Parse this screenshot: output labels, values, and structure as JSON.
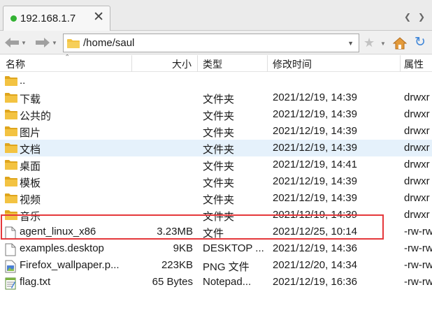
{
  "tab": {
    "title": "192.168.1.7",
    "close": "✕"
  },
  "navbar": {
    "path": "/home/saul"
  },
  "columns": {
    "name": "名称",
    "size": "大小",
    "type": "类型",
    "modified": "修改时间",
    "attr": "属性"
  },
  "colors": {
    "folder": "#f3c342",
    "folder_dark": "#dfa51d",
    "selected_row": "#e5f1fb",
    "highlight_box": "#e5383b",
    "reload": "#3f86d8",
    "online_dot": "#33b233"
  },
  "rows": [
    {
      "icon": "folder-icon",
      "name": "..",
      "size": "",
      "type": "",
      "modified": "",
      "attr": ""
    },
    {
      "icon": "folder-icon",
      "name": "下载",
      "size": "",
      "type": "文件夹",
      "modified": "2021/12/19, 14:39",
      "attr": "drwxr"
    },
    {
      "icon": "folder-icon",
      "name": "公共的",
      "size": "",
      "type": "文件夹",
      "modified": "2021/12/19, 14:39",
      "attr": "drwxr"
    },
    {
      "icon": "folder-icon",
      "name": "图片",
      "size": "",
      "type": "文件夹",
      "modified": "2021/12/19, 14:39",
      "attr": "drwxr"
    },
    {
      "icon": "folder-icon",
      "name": "文档",
      "size": "",
      "type": "文件夹",
      "modified": "2021/12/19, 14:39",
      "attr": "drwxr",
      "selected": true
    },
    {
      "icon": "folder-icon",
      "name": "桌面",
      "size": "",
      "type": "文件夹",
      "modified": "2021/12/19, 14:41",
      "attr": "drwxr"
    },
    {
      "icon": "folder-icon",
      "name": "模板",
      "size": "",
      "type": "文件夹",
      "modified": "2021/12/19, 14:39",
      "attr": "drwxr"
    },
    {
      "icon": "folder-icon",
      "name": "视频",
      "size": "",
      "type": "文件夹",
      "modified": "2021/12/19, 14:39",
      "attr": "drwxr"
    },
    {
      "icon": "folder-icon",
      "name": "音乐",
      "size": "",
      "type": "文件夹",
      "modified": "2021/12/19, 14:39",
      "attr": "drwxr"
    },
    {
      "icon": "file-icon",
      "name": "agent_linux_x86",
      "size": "3.23MB",
      "type": "文件",
      "modified": "2021/12/25, 10:14",
      "attr": "-rw-rw"
    },
    {
      "icon": "file-icon",
      "name": "examples.desktop",
      "size": "9KB",
      "type": "DESKTOP ...",
      "modified": "2021/12/19, 14:36",
      "attr": "-rw-rw"
    },
    {
      "icon": "image-file-icon",
      "name": "Firefox_wallpaper.p...",
      "size": "223KB",
      "type": "PNG 文件",
      "modified": "2021/12/20, 14:34",
      "attr": "-rw-rw"
    },
    {
      "icon": "notepad-file-icon",
      "name": "flag.txt",
      "size": "65 Bytes",
      "type": "Notepad...",
      "modified": "2021/12/19, 16:36",
      "attr": "-rw-rw"
    }
  ]
}
